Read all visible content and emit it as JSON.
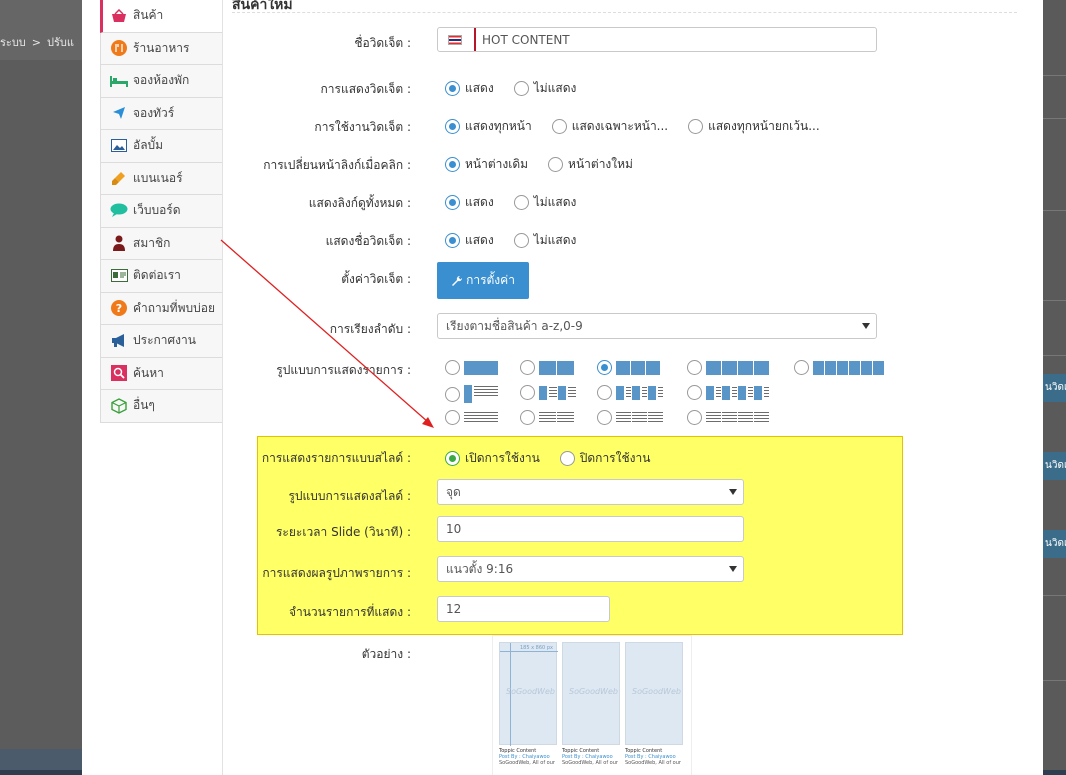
{
  "background": {
    "breadcrumb": [
      "ระบบ",
      ">",
      "ปรับแ"
    ],
    "right_tabs": [
      "นวิดเจ็",
      "นวิดเจ็",
      "นวิดเจ็"
    ]
  },
  "sidebar": {
    "items": [
      {
        "label": "สินค้า",
        "icon": "shopping-basket-icon",
        "color": "#d9305f",
        "active": true
      },
      {
        "label": "ร้านอาหาร",
        "icon": "restaurant-icon",
        "color": "#f07a1a"
      },
      {
        "label": "จองห้องพัก",
        "icon": "bed-icon",
        "color": "#2aa86a"
      },
      {
        "label": "จองทัวร์",
        "icon": "airplane-icon",
        "color": "#2a8fd6"
      },
      {
        "label": "อัลบั้ม",
        "icon": "picture-icon",
        "color": "#2a5f99"
      },
      {
        "label": "แบนเนอร์",
        "icon": "brush-icon",
        "color": "#f0a020"
      },
      {
        "label": "เว็บบอร์ด",
        "icon": "chat-bubble-icon",
        "color": "#1fbf9f"
      },
      {
        "label": "สมาชิก",
        "icon": "user-icon",
        "color": "#7a1a1a"
      },
      {
        "label": "ติดต่อเรา",
        "icon": "contact-card-icon",
        "color": "#3a6d3a"
      },
      {
        "label": "คำถามที่พบบ่อย",
        "icon": "question-icon",
        "color": "#f07a1a"
      },
      {
        "label": "ประกาศงาน",
        "icon": "megaphone-icon",
        "color": "#2a5f99"
      },
      {
        "label": "ค้นหา",
        "icon": "search-icon",
        "color": "#d9305f"
      },
      {
        "label": "อื่นๆ",
        "icon": "box-icon",
        "color": "#3aa03a"
      }
    ]
  },
  "form": {
    "top_title": "สินค้าใหม่",
    "widget_name": {
      "label": "ชื่อวิดเจ็ต :",
      "value": "HOT CONTENT"
    },
    "show_widget": {
      "label": "การแสดงวิดเจ็ต :",
      "options": [
        "แสดง",
        "ไม่แสดง"
      ],
      "selected": 0
    },
    "use_widget": {
      "label": "การใช้งานวิดเจ็ต :",
      "options": [
        "แสดงทุกหน้า",
        "แสดงเฉพาะหน้า...",
        "แสดงทุกหน้ายกเว้น..."
      ],
      "selected": 0
    },
    "link_change": {
      "label": "การเปลี่ยนหน้าลิงก์เมื่อคลิก :",
      "options": [
        "หน้าต่างเดิม",
        "หน้าต่างใหม่"
      ],
      "selected": 0
    },
    "show_all_link": {
      "label": "แสดงลิงก์ดูทั้งหมด :",
      "options": [
        "แสดง",
        "ไม่แสดง"
      ],
      "selected": 0
    },
    "show_widget_name": {
      "label": "แสดงชื่อวิดเจ็ต :",
      "options": [
        "แสดง",
        "ไม่แสดง"
      ],
      "selected": 0
    },
    "widget_settings": {
      "label": "ตั้งค่าวิดเจ็ต :",
      "button": "การตั้งค่า"
    },
    "sort_order": {
      "label": "การเรียงลำดับ :",
      "value": "เรียงตามชื่อสินค้า a-z,0-9"
    },
    "display_layout": {
      "label": "รูปแบบการแสดงรายการ :",
      "selected_index": 2
    },
    "slide": {
      "enable": {
        "label": "การแสดงรายการแบบสไลด์ :",
        "options": [
          "เปิดการใช้งาน",
          "ปิดการใช้งาน"
        ],
        "selected": 0
      },
      "style": {
        "label": "รูปแบบการแสดงสไลด์ :",
        "value": "จุด"
      },
      "interval": {
        "label": "ระยะเวลา Slide (วินาที) :",
        "value": "10"
      },
      "image_display": {
        "label": "การแสดงผลรูปภาพรายการ :",
        "value": "แนวตั้ง 9:16"
      },
      "item_count": {
        "label": "จำนวนรายการที่แสดง :",
        "value": "12"
      }
    },
    "preview": {
      "label": "ตัวอย่าง :",
      "cards": [
        {
          "title": "Toppic Content",
          "by": "Post By : Chaiyawoo",
          "desc": "SoGoodWeb, All of our"
        },
        {
          "title": "Toppic Content",
          "by": "Post By : Chaiyawoo",
          "desc": "SoGoodWeb, All of our"
        },
        {
          "title": "Toppic Content",
          "by": "Post By : Chaiyawoo",
          "desc": "SoGoodWeb, All of our"
        }
      ],
      "watermark": "SoGoodWeb",
      "ruler_text": "185 x 860 px"
    }
  },
  "colors": {
    "accent": "#3a8fd0",
    "highlight": "#ffff66",
    "annotation_arrow": "#e02020"
  }
}
